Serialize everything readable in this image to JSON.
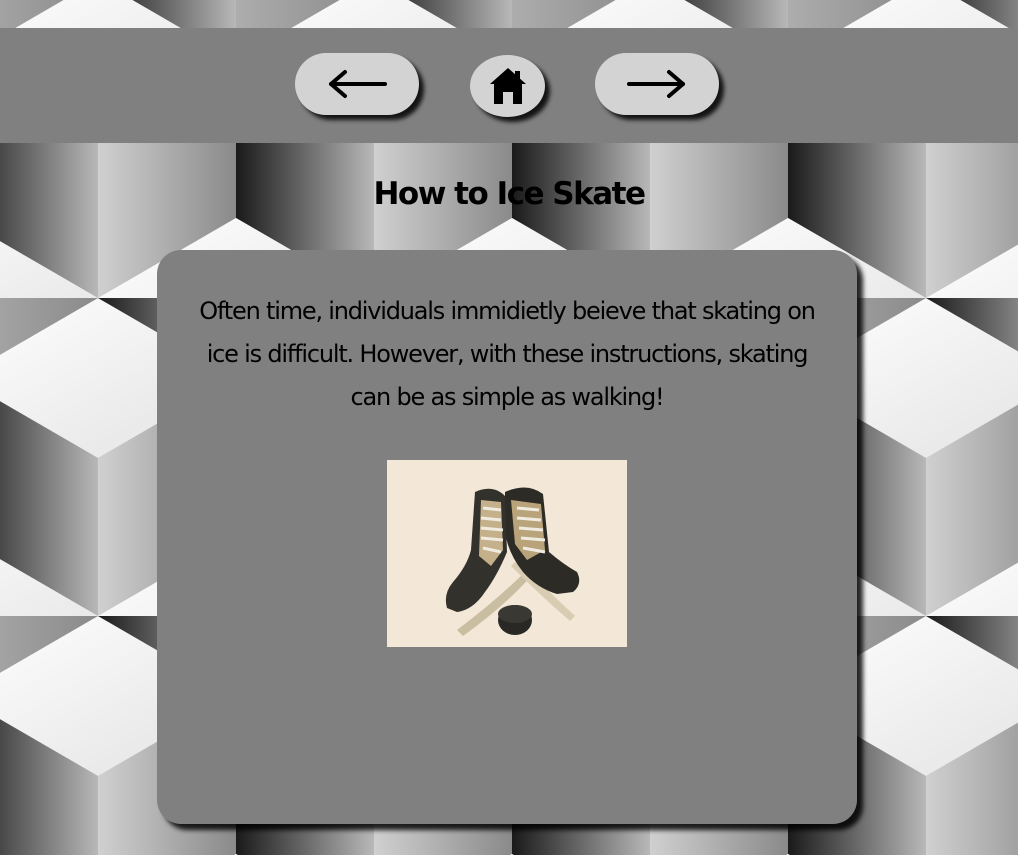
{
  "nav": {
    "back_icon": "arrow-left-icon",
    "home_icon": "home-icon",
    "forward_icon": "arrow-right-icon"
  },
  "page": {
    "title": "How to Ice Skate"
  },
  "content": {
    "intro_text": "Often time, individuals immidietly beieve that skating on ice is difficult. However, with these instructions, skating can be as simple as walking!",
    "image_subject": "ice-skates-and-puck"
  },
  "colors": {
    "navbar": "#808080",
    "card": "#808080",
    "button": "#d3d3d3",
    "image_background": "#f3e8d7"
  }
}
